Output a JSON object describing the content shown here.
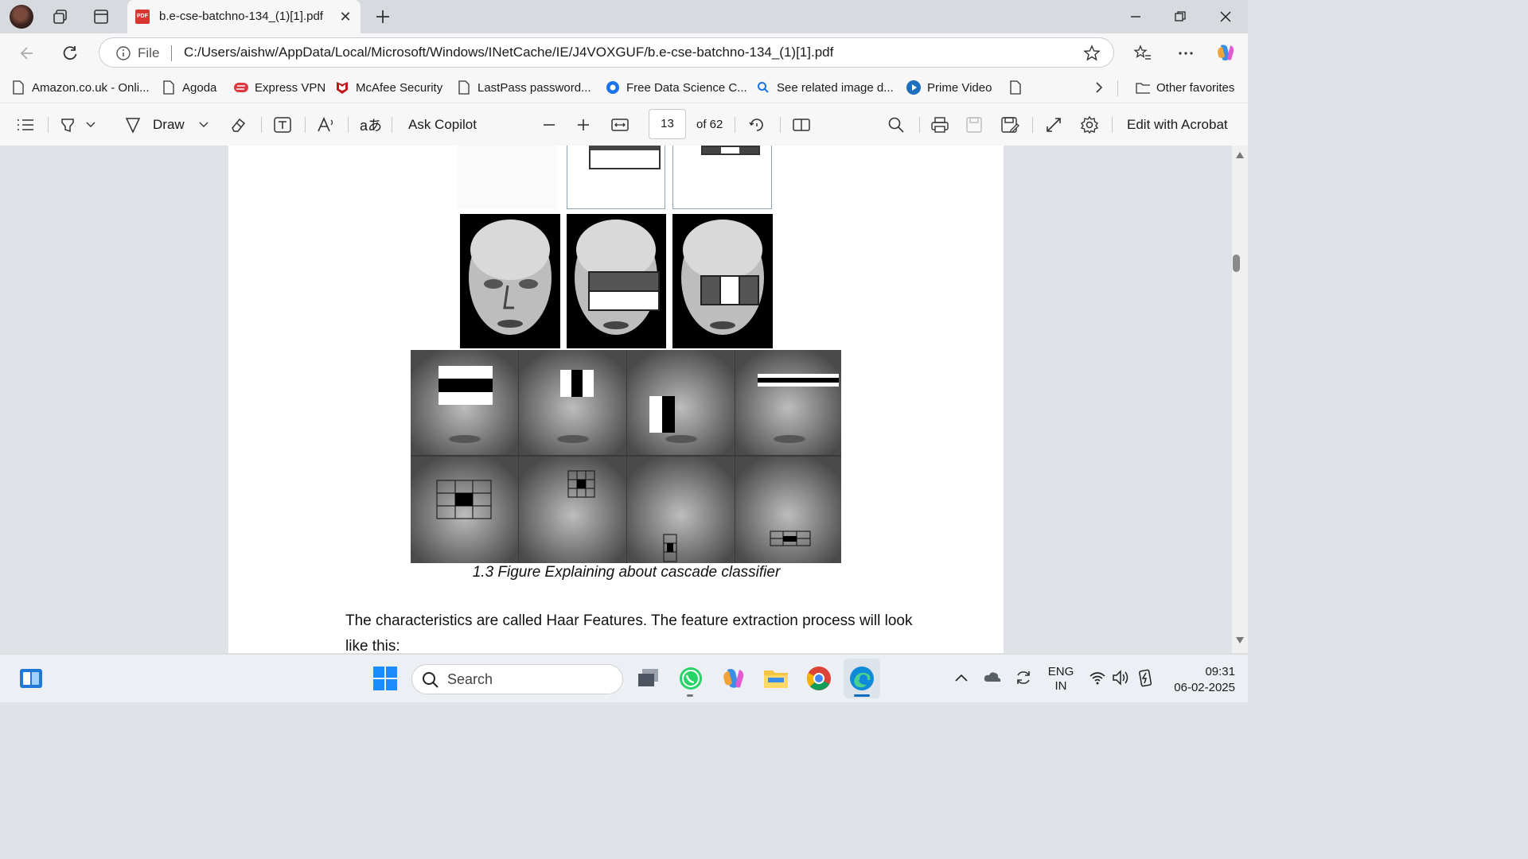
{
  "browser": {
    "tab_title": "b.e-cse-batchno-134_(1)[1].pdf",
    "tab_icon_text": "PDF",
    "url_prefix": "File",
    "url": "C:/Users/aishw/AppData/Local/Microsoft/Windows/INetCache/IE/J4VOXGUF/b.e-cse-batchno-134_(1)[1].pdf"
  },
  "favorites": [
    {
      "label": "Amazon.co.uk - Onli...",
      "icon": "page-icon"
    },
    {
      "label": "Agoda",
      "icon": "page-icon"
    },
    {
      "label": "Express VPN",
      "icon": "expressvpn-icon"
    },
    {
      "label": "McAfee Security",
      "icon": "mcafee-icon"
    },
    {
      "label": "LastPass password...",
      "icon": "page-icon"
    },
    {
      "label": "Free Data Science C...",
      "icon": "cog-blue-icon"
    },
    {
      "label": "See related image d...",
      "icon": "search-blue-icon"
    },
    {
      "label": "Prime Video",
      "icon": "play-icon"
    }
  ],
  "favorites_other": "Other favorites",
  "pdf_toolbar": {
    "draw_label": "Draw",
    "ask_copilot": "Ask Copilot",
    "page_current": "13",
    "page_total": "of 62",
    "edit_acrobat": "Edit with Acrobat"
  },
  "document": {
    "caption": "1.3 Figure Explaining about cascade classifier",
    "paragraph": "The characteristics are called Haar Features. The feature extraction process will look like this:"
  },
  "taskbar": {
    "search_placeholder": "Search",
    "language": "ENG",
    "region": "IN",
    "time": "09:31",
    "date": "06-02-2025"
  },
  "colors": {
    "accent": "#0f6cbd",
    "pdf_red": "#d8362f"
  }
}
